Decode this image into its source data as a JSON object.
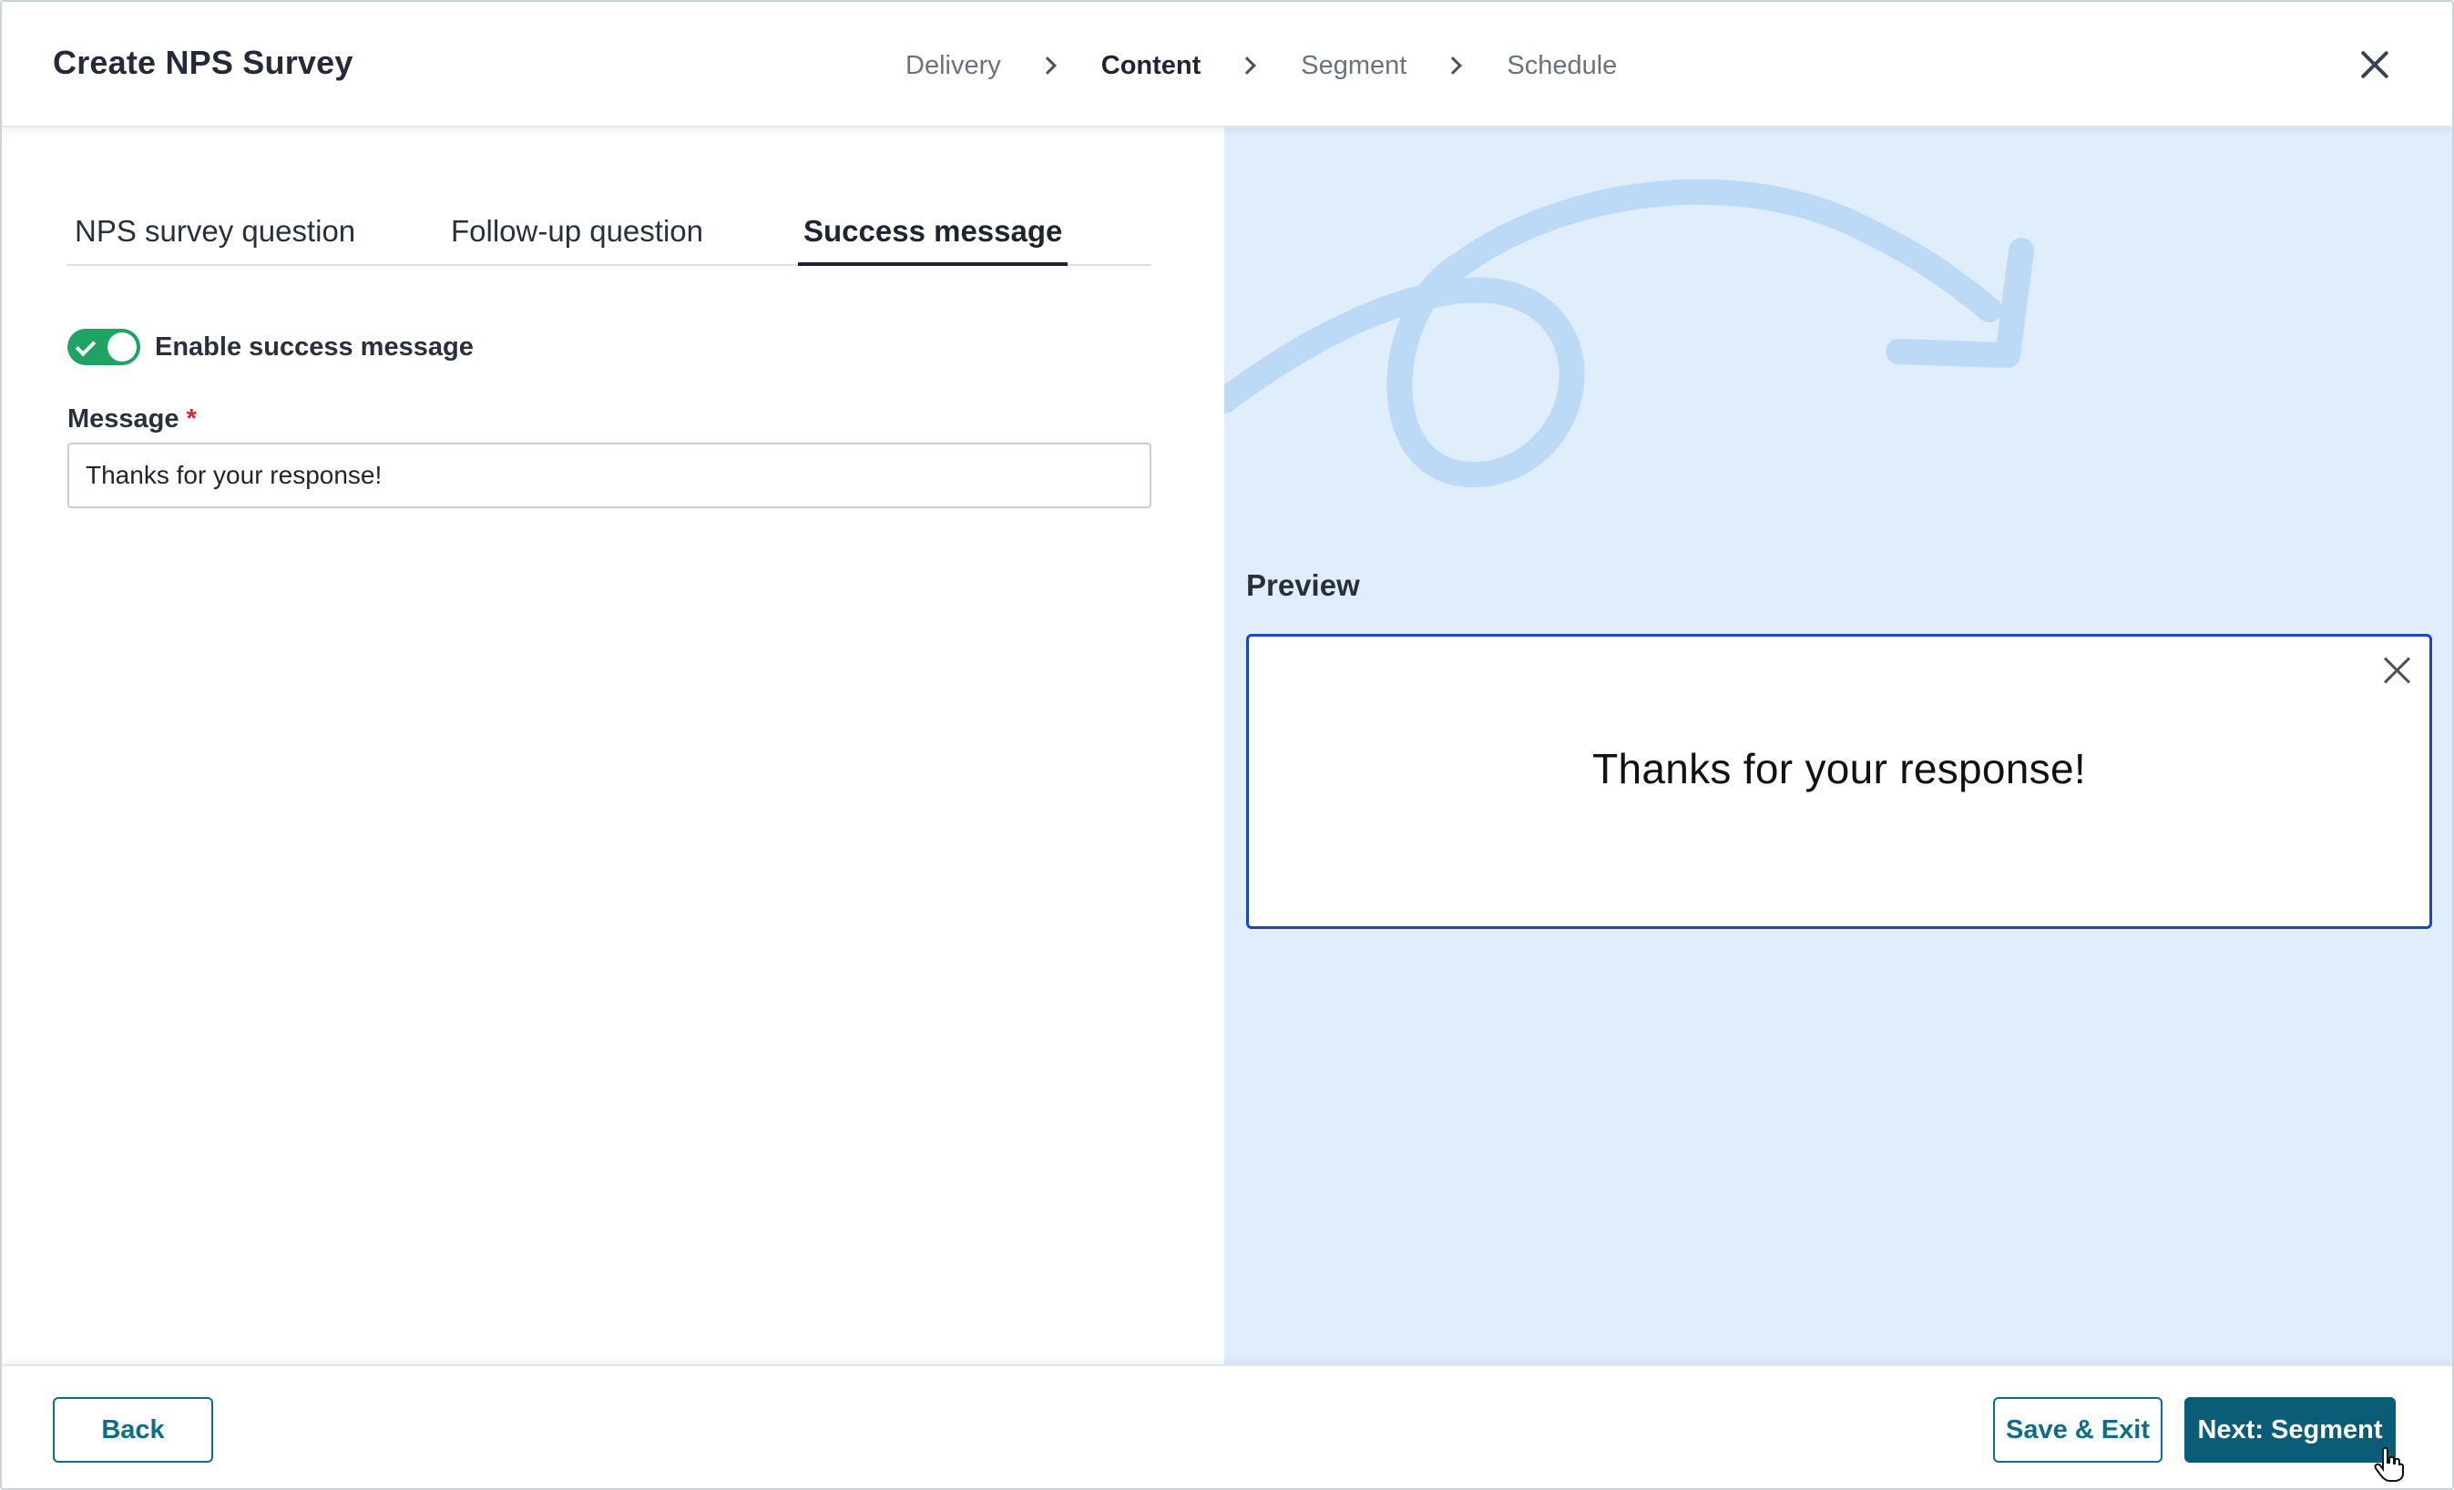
{
  "header": {
    "title": "Create NPS Survey",
    "steps": [
      {
        "label": "Delivery",
        "active": false
      },
      {
        "label": "Content",
        "active": true
      },
      {
        "label": "Segment",
        "active": false
      },
      {
        "label": "Schedule",
        "active": false
      }
    ]
  },
  "tabs": [
    {
      "label": "NPS survey question",
      "active": false
    },
    {
      "label": "Follow-up question",
      "active": false
    },
    {
      "label": "Success message",
      "active": true
    }
  ],
  "form": {
    "toggle_label": "Enable success message",
    "toggle_on": true,
    "message_label": "Message",
    "required_mark": "*",
    "message_value": "Thanks for your response!"
  },
  "preview": {
    "label": "Preview",
    "text": "Thanks for your response!"
  },
  "footer": {
    "back_label": "Back",
    "save_label": "Save & Exit",
    "next_label": "Next: Segment"
  },
  "colors": {
    "accent": "#0b5c77",
    "toggle_on": "#1fa365",
    "preview_border": "#1b47b8",
    "preview_bg": "#e0edfb",
    "required": "#d6262a"
  }
}
